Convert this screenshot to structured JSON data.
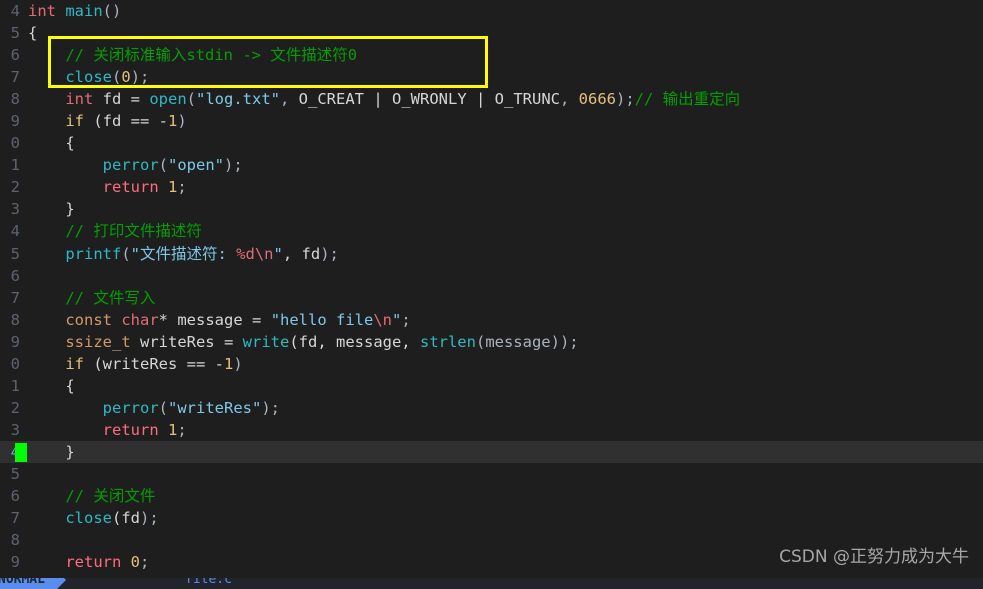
{
  "editor": {
    "app": "vim-text-editor",
    "theme_background": "#1e1e1e",
    "cursorline_background": "#303030",
    "cursor_color": "#00ff00",
    "annotation_border_color": "#ffff00",
    "gutter_color": "#5c6370",
    "cursor_line_number_color": "#56b6c2"
  },
  "lines": [
    {
      "num": "4",
      "cursor": false,
      "tokens": [
        {
          "t": "int",
          "c": "t-type"
        },
        {
          "t": " ",
          "c": "t-var"
        },
        {
          "t": "main",
          "c": "t-fn"
        },
        {
          "t": "()",
          "c": "t-punct"
        }
      ]
    },
    {
      "num": "5",
      "cursor": false,
      "tokens": [
        {
          "t": "{",
          "c": "t-brace"
        }
      ]
    },
    {
      "num": "6",
      "cursor": false,
      "tokens": [
        {
          "t": "    ",
          "c": "t-var"
        },
        {
          "t": "// 关闭标准输入stdin -> 文件描述符0",
          "c": "t-comment"
        }
      ]
    },
    {
      "num": "7",
      "cursor": false,
      "tokens": [
        {
          "t": "    ",
          "c": "t-var"
        },
        {
          "t": "close",
          "c": "t-fn"
        },
        {
          "t": "(",
          "c": "t-punct"
        },
        {
          "t": "0",
          "c": "t-num"
        },
        {
          "t": ");",
          "c": "t-punct"
        }
      ]
    },
    {
      "num": "8",
      "cursor": false,
      "tokens": [
        {
          "t": "    ",
          "c": "t-var"
        },
        {
          "t": "int",
          "c": "t-type"
        },
        {
          "t": " fd ",
          "c": "t-var"
        },
        {
          "t": "= ",
          "c": "t-op"
        },
        {
          "t": "open",
          "c": "t-fn"
        },
        {
          "t": "(",
          "c": "t-punct"
        },
        {
          "t": "\"log.txt\"",
          "c": "t-str"
        },
        {
          "t": ", ",
          "c": "t-punct"
        },
        {
          "t": "O_CREAT",
          "c": "t-macro"
        },
        {
          "t": " | ",
          "c": "t-op"
        },
        {
          "t": "O_WRONLY",
          "c": "t-macro"
        },
        {
          "t": " | ",
          "c": "t-op"
        },
        {
          "t": "O_TRUNC",
          "c": "t-macro"
        },
        {
          "t": ", ",
          "c": "t-punct"
        },
        {
          "t": "0666",
          "c": "t-num"
        },
        {
          "t": ");",
          "c": "t-punct"
        },
        {
          "t": "// 输出重定向",
          "c": "t-comment"
        }
      ]
    },
    {
      "num": "9",
      "cursor": false,
      "tokens": [
        {
          "t": "    ",
          "c": "t-var"
        },
        {
          "t": "if",
          "c": "t-kw"
        },
        {
          "t": " (fd ",
          "c": "t-var"
        },
        {
          "t": "== ",
          "c": "t-op"
        },
        {
          "t": "-",
          "c": "t-op"
        },
        {
          "t": "1",
          "c": "t-num"
        },
        {
          "t": ")",
          "c": "t-punct"
        }
      ]
    },
    {
      "num": "0",
      "cursor": false,
      "tokens": [
        {
          "t": "    ",
          "c": "t-var"
        },
        {
          "t": "{",
          "c": "t-brace"
        }
      ]
    },
    {
      "num": "1",
      "cursor": false,
      "tokens": [
        {
          "t": "        ",
          "c": "t-var"
        },
        {
          "t": "perror",
          "c": "t-fn"
        },
        {
          "t": "(",
          "c": "t-punct"
        },
        {
          "t": "\"open\"",
          "c": "t-str"
        },
        {
          "t": ");",
          "c": "t-punct"
        }
      ]
    },
    {
      "num": "2",
      "cursor": false,
      "tokens": [
        {
          "t": "        ",
          "c": "t-var"
        },
        {
          "t": "return",
          "c": "t-ret"
        },
        {
          "t": " ",
          "c": "t-var"
        },
        {
          "t": "1",
          "c": "t-num"
        },
        {
          "t": ";",
          "c": "t-punct"
        }
      ]
    },
    {
      "num": "3",
      "cursor": false,
      "tokens": [
        {
          "t": "    ",
          "c": "t-var"
        },
        {
          "t": "}",
          "c": "t-brace"
        }
      ]
    },
    {
      "num": "4",
      "cursor": false,
      "tokens": [
        {
          "t": "    ",
          "c": "t-var"
        },
        {
          "t": "// 打印文件描述符",
          "c": "t-comment"
        }
      ]
    },
    {
      "num": "5",
      "cursor": false,
      "tokens": [
        {
          "t": "    ",
          "c": "t-var"
        },
        {
          "t": "printf",
          "c": "t-fn"
        },
        {
          "t": "(",
          "c": "t-punct"
        },
        {
          "t": "\"文件描述符: ",
          "c": "t-str"
        },
        {
          "t": "%d",
          "c": "t-esc"
        },
        {
          "t": "\\n",
          "c": "t-esc"
        },
        {
          "t": "\"",
          "c": "t-str"
        },
        {
          "t": ", fd",
          "c": "t-var"
        },
        {
          "t": ");",
          "c": "t-punct"
        }
      ]
    },
    {
      "num": "6",
      "cursor": false,
      "tokens": []
    },
    {
      "num": "7",
      "cursor": false,
      "tokens": [
        {
          "t": "    ",
          "c": "t-var"
        },
        {
          "t": "// 文件写入",
          "c": "t-comment"
        }
      ]
    },
    {
      "num": "8",
      "cursor": false,
      "tokens": [
        {
          "t": "    ",
          "c": "t-var"
        },
        {
          "t": "const",
          "c": "t-const"
        },
        {
          "t": " ",
          "c": "t-var"
        },
        {
          "t": "char",
          "c": "t-type"
        },
        {
          "t": "*",
          "c": "t-op"
        },
        {
          "t": " message ",
          "c": "t-var"
        },
        {
          "t": "= ",
          "c": "t-op"
        },
        {
          "t": "\"hello file",
          "c": "t-str"
        },
        {
          "t": "\\n",
          "c": "t-esc"
        },
        {
          "t": "\"",
          "c": "t-str"
        },
        {
          "t": ";",
          "c": "t-punct"
        }
      ]
    },
    {
      "num": "9",
      "cursor": false,
      "tokens": [
        {
          "t": "    ",
          "c": "t-var"
        },
        {
          "t": "ssize_t",
          "c": "t-const"
        },
        {
          "t": " writeRes ",
          "c": "t-var"
        },
        {
          "t": "= ",
          "c": "t-op"
        },
        {
          "t": "write",
          "c": "t-fn"
        },
        {
          "t": "(fd, message, ",
          "c": "t-var"
        },
        {
          "t": "strlen",
          "c": "t-fn"
        },
        {
          "t": "(message));",
          "c": "t-punct"
        }
      ]
    },
    {
      "num": "0",
      "cursor": false,
      "tokens": [
        {
          "t": "    ",
          "c": "t-var"
        },
        {
          "t": "if",
          "c": "t-kw"
        },
        {
          "t": " (writeRes ",
          "c": "t-var"
        },
        {
          "t": "== ",
          "c": "t-op"
        },
        {
          "t": "-",
          "c": "t-op"
        },
        {
          "t": "1",
          "c": "t-num"
        },
        {
          "t": ")",
          "c": "t-punct"
        }
      ]
    },
    {
      "num": "1",
      "cursor": false,
      "tokens": [
        {
          "t": "    ",
          "c": "t-var"
        },
        {
          "t": "{",
          "c": "t-brace"
        }
      ]
    },
    {
      "num": "2",
      "cursor": false,
      "tokens": [
        {
          "t": "        ",
          "c": "t-var"
        },
        {
          "t": "perror",
          "c": "t-fn"
        },
        {
          "t": "(",
          "c": "t-punct"
        },
        {
          "t": "\"writeRes\"",
          "c": "t-str"
        },
        {
          "t": ");",
          "c": "t-punct"
        }
      ]
    },
    {
      "num": "3",
      "cursor": false,
      "tokens": [
        {
          "t": "        ",
          "c": "t-var"
        },
        {
          "t": "return",
          "c": "t-ret"
        },
        {
          "t": " ",
          "c": "t-var"
        },
        {
          "t": "1",
          "c": "t-num"
        },
        {
          "t": ";",
          "c": "t-punct"
        }
      ]
    },
    {
      "num": "4",
      "cursor": true,
      "tokens": [
        {
          "t": "    ",
          "c": "t-var"
        },
        {
          "t": "}",
          "c": "t-brace"
        }
      ]
    },
    {
      "num": "5",
      "cursor": false,
      "tokens": []
    },
    {
      "num": "6",
      "cursor": false,
      "tokens": [
        {
          "t": "    ",
          "c": "t-var"
        },
        {
          "t": "// 关闭文件",
          "c": "t-comment"
        }
      ]
    },
    {
      "num": "7",
      "cursor": false,
      "tokens": [
        {
          "t": "    ",
          "c": "t-var"
        },
        {
          "t": "close",
          "c": "t-fn"
        },
        {
          "t": "(fd",
          "c": "t-var"
        },
        {
          "t": ");",
          "c": "t-punct"
        }
      ]
    },
    {
      "num": "8",
      "cursor": false,
      "tokens": []
    },
    {
      "num": "9",
      "cursor": false,
      "tokens": [
        {
          "t": "    ",
          "c": "t-var"
        },
        {
          "t": "return",
          "c": "t-ret"
        },
        {
          "t": " ",
          "c": "t-var"
        },
        {
          "t": "0",
          "c": "t-num"
        },
        {
          "t": ";",
          "c": "t-punct"
        }
      ]
    }
  ],
  "annotation": {
    "label": "highlight-box",
    "color": "#ffff00"
  },
  "watermark": {
    "text": "CSDN @正努力成为大牛"
  },
  "statusbar": {
    "mode": "NORMAL",
    "filename": "file.c"
  }
}
